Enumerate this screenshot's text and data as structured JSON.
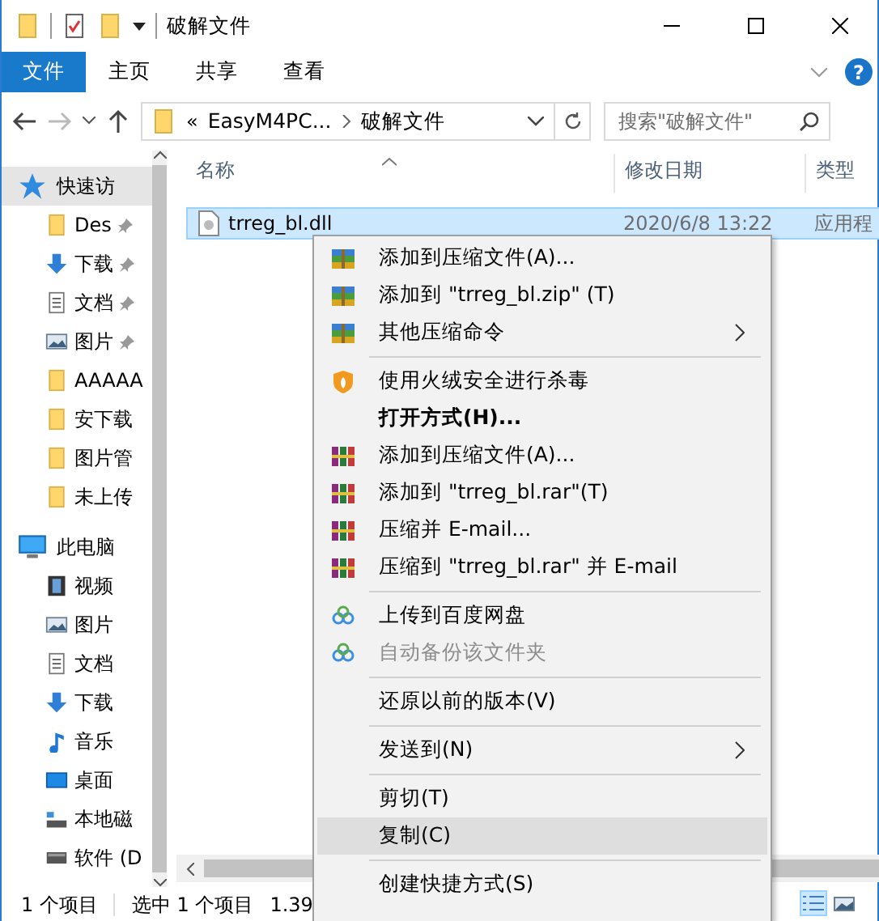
{
  "window": {
    "title": "破解文件"
  },
  "ribbon_tabs": [
    {
      "label": "文件",
      "kind": "file"
    },
    {
      "label": "主页",
      "kind": "tab"
    },
    {
      "label": "共享",
      "kind": "tab"
    },
    {
      "label": "查看",
      "kind": "tab"
    }
  ],
  "help_button": "?",
  "navigation": {
    "back_disabled": false,
    "forward_disabled": true
  },
  "address": {
    "overflow": "«",
    "path": [
      "EasyM4PC...",
      "破解文件"
    ]
  },
  "search": {
    "placeholder": "搜索\"破解文件\""
  },
  "sidebar": {
    "items": [
      {
        "label": "快速访",
        "selected": true,
        "children": [
          {
            "label": "Des",
            "pinned": true,
            "selected": false
          },
          {
            "label": "下载",
            "pinned": true,
            "selected": false
          },
          {
            "label": "文档",
            "pinned": true,
            "selected": false
          },
          {
            "label": "图片",
            "pinned": true,
            "selected": false
          },
          {
            "label": "AAAAA",
            "pinned": false,
            "selected": false
          },
          {
            "label": "安下载",
            "pinned": false,
            "selected": false
          },
          {
            "label": "图片管",
            "pinned": false,
            "selected": false
          },
          {
            "label": "未上传",
            "pinned": false,
            "selected": false
          }
        ]
      },
      {
        "label": "此电脑",
        "selected": false,
        "children": [
          {
            "label": "视频",
            "selected": false
          },
          {
            "label": "图片",
            "selected": false
          },
          {
            "label": "文档",
            "selected": false
          },
          {
            "label": "下载",
            "selected": false
          },
          {
            "label": "音乐",
            "selected": false
          },
          {
            "label": "桌面",
            "selected": false
          },
          {
            "label": "本地磁",
            "selected": false
          },
          {
            "label": "软件 (D",
            "selected": false
          }
        ]
      }
    ]
  },
  "file_list": {
    "columns": [
      "名称",
      "修改日期",
      "类型"
    ],
    "rows": [
      {
        "cells": [
          "trreg_bl.dll",
          "2020/6/8 13:22",
          "应用程"
        ],
        "selected": true
      }
    ]
  },
  "context_menu": {
    "items": [
      {
        "kind": "item",
        "label": "添加到压缩文件(A)..."
      },
      {
        "kind": "item",
        "label": "添加到 \"trreg_bl.zip\" (T)"
      },
      {
        "kind": "item",
        "label": "其他压缩命令",
        "submenu": true
      },
      {
        "kind": "separator"
      },
      {
        "kind": "item",
        "label": "使用火绒安全进行杀毒"
      },
      {
        "kind": "item",
        "label": "打开方式(H)...",
        "bold": true
      },
      {
        "kind": "item",
        "label": "添加到压缩文件(A)..."
      },
      {
        "kind": "item",
        "label": "添加到 \"trreg_bl.rar\"(T)"
      },
      {
        "kind": "item",
        "label": "压缩并 E-mail..."
      },
      {
        "kind": "item",
        "label": "压缩到 \"trreg_bl.rar\" 并 E-mail"
      },
      {
        "kind": "separator"
      },
      {
        "kind": "item",
        "label": "上传到百度网盘"
      },
      {
        "kind": "item",
        "label": "自动备份该文件夹",
        "disabled": true
      },
      {
        "kind": "separator"
      },
      {
        "kind": "item",
        "label": "还原以前的版本(V)"
      },
      {
        "kind": "separator"
      },
      {
        "kind": "item",
        "label": "发送到(N)",
        "submenu": true
      },
      {
        "kind": "separator"
      },
      {
        "kind": "item",
        "label": "剪切(T)"
      },
      {
        "kind": "item",
        "label": "复制(C)",
        "hovered": true
      },
      {
        "kind": "separator"
      },
      {
        "kind": "item",
        "label": "创建快捷方式(S)"
      }
    ]
  },
  "status_bar": {
    "item_count": "1 个项目",
    "selection": "选中 1 个项目",
    "size": "1.39"
  },
  "view_buttons": [
    {
      "kind": "details",
      "selected": true
    },
    {
      "kind": "thumbnails",
      "selected": false
    }
  ]
}
